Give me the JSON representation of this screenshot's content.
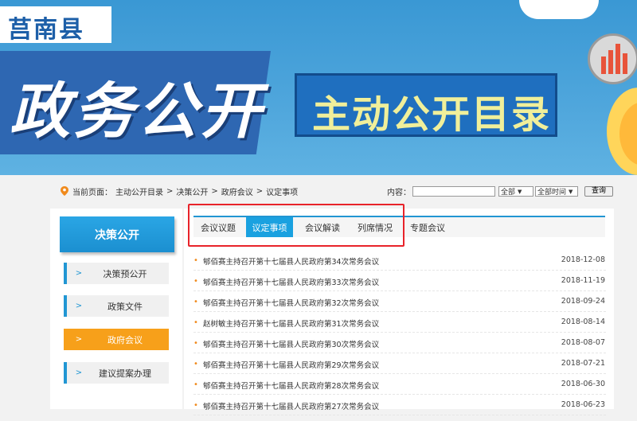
{
  "banner": {
    "county": "莒南县",
    "main_title": "政务公开",
    "sub_title": "主动公开目录"
  },
  "breadcrumb": {
    "prefix": "当前页面：",
    "items": [
      "主动公开目录",
      "决策公开",
      "政府会议",
      "议定事项"
    ],
    "separator": ">"
  },
  "search": {
    "label": "内容：",
    "input_value": "",
    "scope_selected": "全部",
    "time_selected": "全部时间",
    "button_label": "查询"
  },
  "sidebar": {
    "header": "决策公开",
    "items": [
      {
        "label": "决策预公开",
        "active": false
      },
      {
        "label": "政策文件",
        "active": false
      },
      {
        "label": "政府会议",
        "active": true
      },
      {
        "label": "建议提案办理",
        "active": false
      }
    ]
  },
  "tabs": [
    {
      "label": "会议议题",
      "active": false
    },
    {
      "label": "议定事项",
      "active": true
    },
    {
      "label": "会议解读",
      "active": false
    },
    {
      "label": "列席情况",
      "active": false
    },
    {
      "label": "专题会议",
      "active": false
    }
  ],
  "list": [
    {
      "title": "郇佰赛主持召开第十七届县人民政府第34次常务会议",
      "date": "2018-12-08"
    },
    {
      "title": "郇佰赛主持召开第十七届县人民政府第33次常务会议",
      "date": "2018-11-19"
    },
    {
      "title": "郇佰赛主持召开第十七届县人民政府第32次常务会议",
      "date": "2018-09-24"
    },
    {
      "title": "赵树敏主持召开第十七届县人民政府第31次常务会议",
      "date": "2018-08-14"
    },
    {
      "title": "郇佰赛主持召开第十七届县人民政府第30次常务会议",
      "date": "2018-08-07"
    },
    {
      "title": "郇佰赛主持召开第十七届县人民政府第29次常务会议",
      "date": "2018-07-21"
    },
    {
      "title": "郇佰赛主持召开第十七届县人民政府第28次常务会议",
      "date": "2018-06-30"
    },
    {
      "title": "郇佰赛主持召开第十七届县人民政府第27次常务会议",
      "date": "2018-06-23"
    }
  ],
  "colors": {
    "accent_blue": "#1aa1e0",
    "active_orange": "#f7a01a",
    "highlight_red": "#e8232a"
  },
  "icons": {
    "breadcrumb": "location-pin-icon",
    "side_item": "chevron-right-icon",
    "list_bullet": "dot-icon"
  }
}
